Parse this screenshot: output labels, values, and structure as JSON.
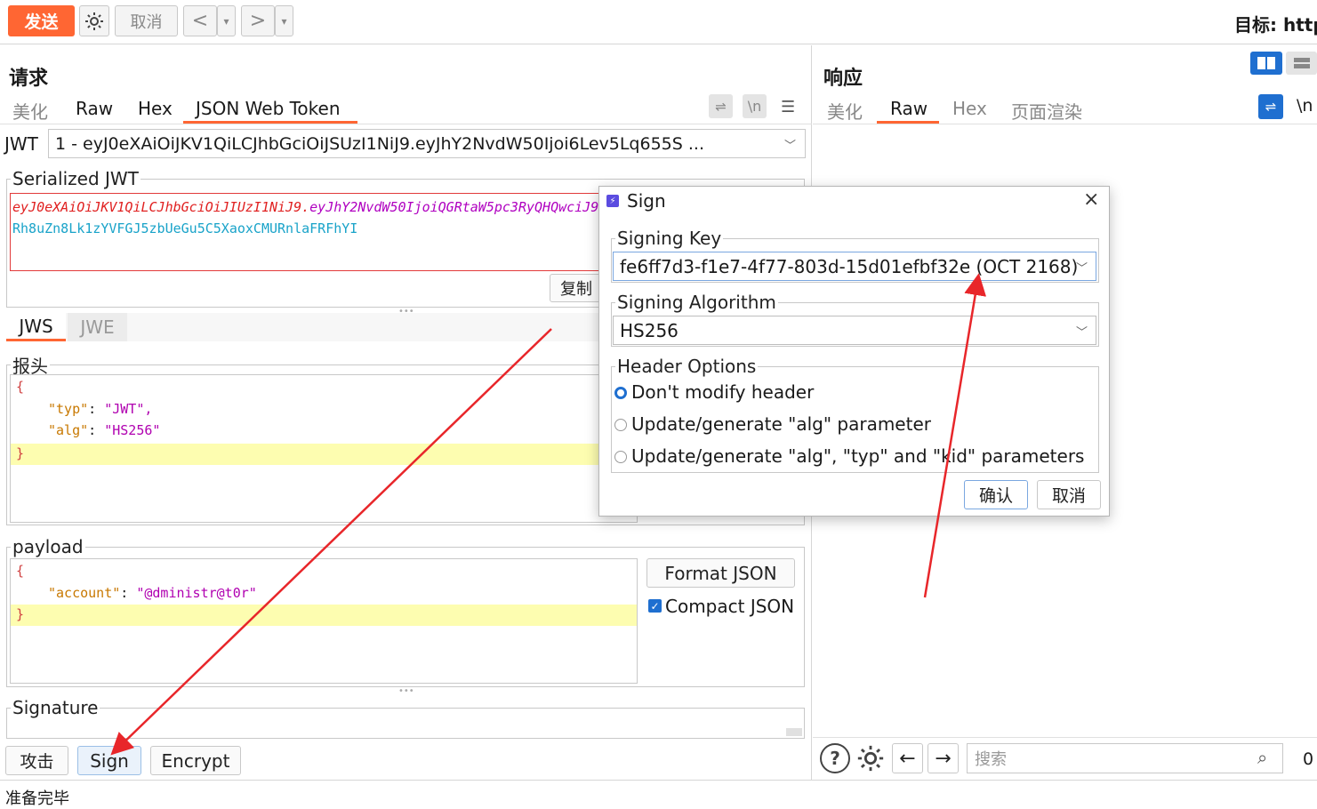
{
  "toolbar": {
    "send": "发送",
    "cancel": "取消",
    "back": "<",
    "forward": ">",
    "dropdown": "▾",
    "target_label": "目标: http"
  },
  "request": {
    "title": "请求",
    "tabs": [
      "美化",
      "Raw",
      "Hex",
      "JSON Web Token"
    ],
    "jwt_label": "JWT",
    "jwt_value": "1 - eyJ0eXAiOiJKV1QiLCJhbGciOiJSUzI1NiJ9.eyJhY2NvdW50Ijoi6Lev5Lq655S ...",
    "serialized_legend": "Serialized JWT",
    "serialized_line1_header": "eyJ0eXAiOiJKV1QiLCJhbGciOiJIUzI1NiJ9.",
    "serialized_line1_payload": "eyJhY2NvdW50IjoiQGRtaW5pc3RyQHQwciJ9.",
    "serialized_line2": "Rh8uZn8Lk1zYVFGJ5zbUeGu5C5XaoxCMURnlaFRFhYI",
    "copy_button": "复制",
    "jw_tabs": [
      "JWS",
      "JWE"
    ],
    "header_legend": "报头",
    "header_lines": {
      "open": "{",
      "typ_key": "\"typ\"",
      "typ_val": "\"JWT\",",
      "alg_key": "\"alg\"",
      "alg_val": "\"HS256\"",
      "close": "}",
      "colon": ":"
    },
    "payload_legend": "payload",
    "payload_lines": {
      "open": "{",
      "account_key": "\"account\"",
      "account_val": "\"@dministr@t0r\"",
      "close": "}",
      "colon": ":"
    },
    "format_json": "Format JSON",
    "compact_json": "Compact JSON",
    "signature_legend": "Signature",
    "buttons": {
      "attack": "攻击",
      "sign": "Sign",
      "encrypt": "Encrypt"
    }
  },
  "response": {
    "title": "响应",
    "tabs": [
      "美化",
      "Raw",
      "Hex",
      "页面渲染"
    ],
    "newline_icon": "\\n",
    "search_placeholder": "搜索",
    "match_count": "0"
  },
  "status": "准备完毕",
  "dialog": {
    "title": "Sign",
    "close": "×",
    "signing_key_legend": "Signing Key",
    "signing_key_value": "fe6ff7d3-f1e7-4f77-803d-15d01efbf32e (OCT 2168)",
    "algorithm_legend": "Signing Algorithm",
    "algorithm_value": "HS256",
    "header_options_legend": "Header Options",
    "options": [
      "Don't modify header",
      "Update/generate \"alg\" parameter",
      "Update/generate \"alg\", \"typ\" and \"kid\" parameters"
    ],
    "selected_option": 0,
    "ok": "确认",
    "cancel": "取消"
  },
  "colors": {
    "accent": "#ff6633",
    "annotation_arrow": "#e8262a",
    "tab_underline": "#ff6633"
  }
}
